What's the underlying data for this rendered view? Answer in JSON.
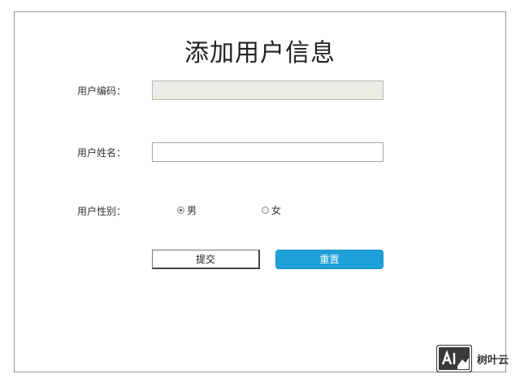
{
  "form": {
    "title": "添加用户信息",
    "code_label": "用户编码：",
    "code_value": "",
    "name_label": "用户姓名：",
    "name_value": "",
    "gender_label": "用户性别：",
    "gender_options": [
      {
        "label": "男",
        "selected": true
      },
      {
        "label": "女",
        "selected": false
      }
    ],
    "submit_label": "提交",
    "reset_label": "重置"
  },
  "watermark": {
    "logo_text": "AI",
    "text": "树叶云"
  },
  "colors": {
    "reset_button": "#1ea1d9",
    "readonly_input": "#ededE6",
    "border": "#9a9a9a"
  }
}
